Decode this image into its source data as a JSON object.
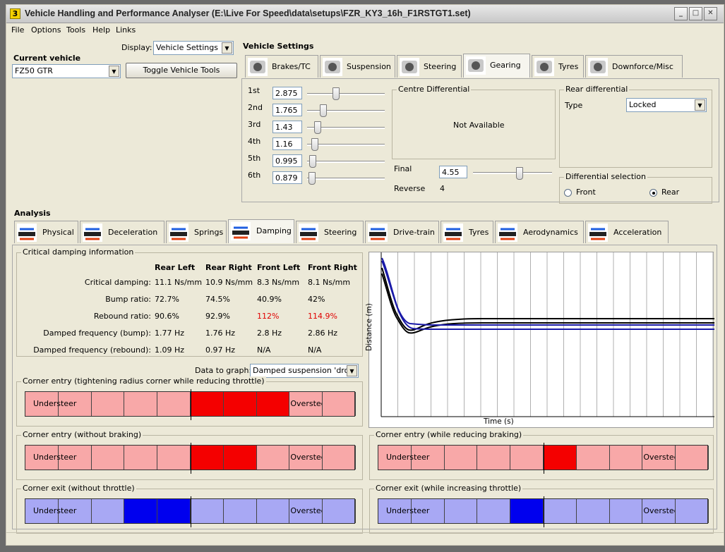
{
  "window": {
    "title": "Vehicle Handling and Performance Analyser (E:\\Live For Speed\\data\\setups\\FZR_KY3_16h_F1RSTGT1.set)",
    "app_icon": "3"
  },
  "menu": [
    "File",
    "Options",
    "Tools",
    "Help",
    "Links"
  ],
  "left": {
    "display_label": "Display:",
    "display_value": "Vehicle Settings",
    "current_vehicle_label": "Current vehicle",
    "vehicle_value": "FZ50 GTR",
    "toggle_button": "Toggle Vehicle Tools"
  },
  "vehicle_settings": {
    "heading": "Vehicle Settings",
    "tabs": [
      {
        "label": "Brakes/TC",
        "icon": "brake-icon"
      },
      {
        "label": "Suspension",
        "icon": "suspension-icon"
      },
      {
        "label": "Steering",
        "icon": "steering-wheel-icon"
      },
      {
        "label": "Gearing",
        "icon": "gear-stick-icon"
      },
      {
        "label": "Tyres",
        "icon": "tyre-icon"
      },
      {
        "label": "Downforce/Misc",
        "icon": "downforce-icon"
      }
    ],
    "active_tab": "Gearing",
    "gears": [
      {
        "label": "1st",
        "value": "2.875",
        "slider": 0.36
      },
      {
        "label": "2nd",
        "value": "1.765",
        "slider": 0.18
      },
      {
        "label": "3rd",
        "value": "1.43",
        "slider": 0.1
      },
      {
        "label": "4th",
        "value": "1.16",
        "slider": 0.06
      },
      {
        "label": "5th",
        "value": "0.995",
        "slider": 0.03
      },
      {
        "label": "6th",
        "value": "0.879",
        "slider": 0.02
      }
    ],
    "centre_diff": {
      "title": "Centre Differential",
      "text": "Not Available"
    },
    "final_label": "Final",
    "final_value": "4.55",
    "final_slider": 0.6,
    "reverse_label": "Reverse",
    "reverse_value": "4",
    "rear_diff": {
      "title": "Rear differential",
      "type_label": "Type",
      "type_value": "Locked"
    },
    "diff_selection": {
      "title": "Differential selection",
      "front": "Front",
      "rear": "Rear",
      "selected": "Rear"
    }
  },
  "analysis": {
    "heading": "Analysis",
    "tabs": [
      {
        "label": "Physical",
        "icon": "car-profile-icon"
      },
      {
        "label": "Deceleration",
        "icon": "deceleration-icon"
      },
      {
        "label": "Springs",
        "icon": "spring-icon"
      },
      {
        "label": "Damping",
        "icon": "damper-icon"
      },
      {
        "label": "Steering",
        "icon": "steering-rack-icon"
      },
      {
        "label": "Drive-train",
        "icon": "drivetrain-icon"
      },
      {
        "label": "Tyres",
        "icon": "tyre-icon"
      },
      {
        "label": "Aerodynamics",
        "icon": "aero-icon"
      },
      {
        "label": "Acceleration",
        "icon": "acceleration-icon"
      }
    ],
    "active_tab": "Damping",
    "critical": {
      "title": "Critical damping information",
      "columns": [
        "Rear Left",
        "Rear Right",
        "Front Left",
        "Front Right"
      ],
      "rows": [
        {
          "label": "Critical damping:",
          "values": [
            "11.1 Ns/mm",
            "10.9 Ns/mm",
            "8.3 Ns/mm",
            "8.1 Ns/mm"
          ],
          "red": [
            false,
            false,
            false,
            false
          ]
        },
        {
          "label": "Bump ratio:",
          "values": [
            "72.7%",
            "74.5%",
            "40.9%",
            "42%"
          ],
          "red": [
            false,
            false,
            false,
            false
          ]
        },
        {
          "label": "Rebound ratio:",
          "values": [
            "90.6%",
            "92.9%",
            "112%",
            "114.9%"
          ],
          "red": [
            false,
            false,
            true,
            true
          ]
        },
        {
          "label": "Damped frequency (bump):",
          "values": [
            "1.77 Hz",
            "1.76 Hz",
            "2.8 Hz",
            "2.86 Hz"
          ],
          "red": [
            false,
            false,
            false,
            false
          ]
        },
        {
          "label": "Damped frequency (rebound):",
          "values": [
            "1.09 Hz",
            "0.97 Hz",
            "N/A",
            "N/A"
          ],
          "red": [
            false,
            false,
            false,
            false
          ]
        }
      ]
    },
    "graph": {
      "data_label": "Data to graph:",
      "data_value": "Damped suspension 'drop'",
      "ylabel": "Distance (m)",
      "xlabel": "Time (s)"
    },
    "balance": [
      {
        "title": "Corner entry (tightening radius corner while reducing throttle)",
        "color": "red",
        "filled_from": 5,
        "filled_to": 8,
        "left": "Understeer",
        "right": "Oversteer"
      },
      {
        "title": "Corner entry (without braking)",
        "color": "red",
        "filled_from": 5,
        "filled_to": 7,
        "left": "Understeer",
        "right": "Oversteer"
      },
      {
        "title": "Corner entry (while reducing braking)",
        "color": "red",
        "filled_from": 5,
        "filled_to": 6,
        "left": "Understeer",
        "right": "Oversteer"
      },
      {
        "title": "Corner exit (without throttle)",
        "color": "blue",
        "filled_from": 3,
        "filled_to": 5,
        "left": "Understeer",
        "right": "Oversteer"
      },
      {
        "title": "Corner exit (while increasing throttle)",
        "color": "blue",
        "filled_from": 4,
        "filled_to": 5,
        "left": "Understeer",
        "right": "Oversteer"
      }
    ],
    "colors": {
      "red_light": "#f8a8a8",
      "red_dark": "#f40000",
      "blue_light": "#a8a8f4",
      "blue_dark": "#0000ee",
      "warning_text": "#e00000"
    }
  }
}
